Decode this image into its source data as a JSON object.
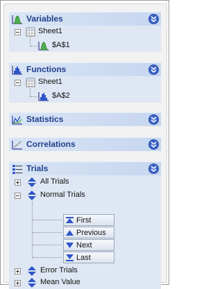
{
  "sections": {
    "variables": {
      "title": "Variables",
      "tree": {
        "sheet": "Sheet1",
        "cell": "$A$1"
      }
    },
    "functions": {
      "title": "Functions",
      "tree": {
        "sheet": "Sheet1",
        "cell": "$A$2"
      }
    },
    "statistics": {
      "title": "Statistics"
    },
    "correlations": {
      "title": "Correlations"
    },
    "trials": {
      "title": "Trials",
      "items": {
        "all_trials": "All Trials",
        "normal_trials": "Normal Trials",
        "error_trials": "Error Trials",
        "mean_value": "Mean Value"
      },
      "nav_buttons": {
        "first": "First",
        "previous": "Previous",
        "next": "Next",
        "last": "Last"
      }
    }
  },
  "colors": {
    "header_text": "#1f3f8a",
    "header_bg": "#c6d6ef",
    "collapse_button": "#3a62c8",
    "body_bg": "#dfe7f4"
  }
}
